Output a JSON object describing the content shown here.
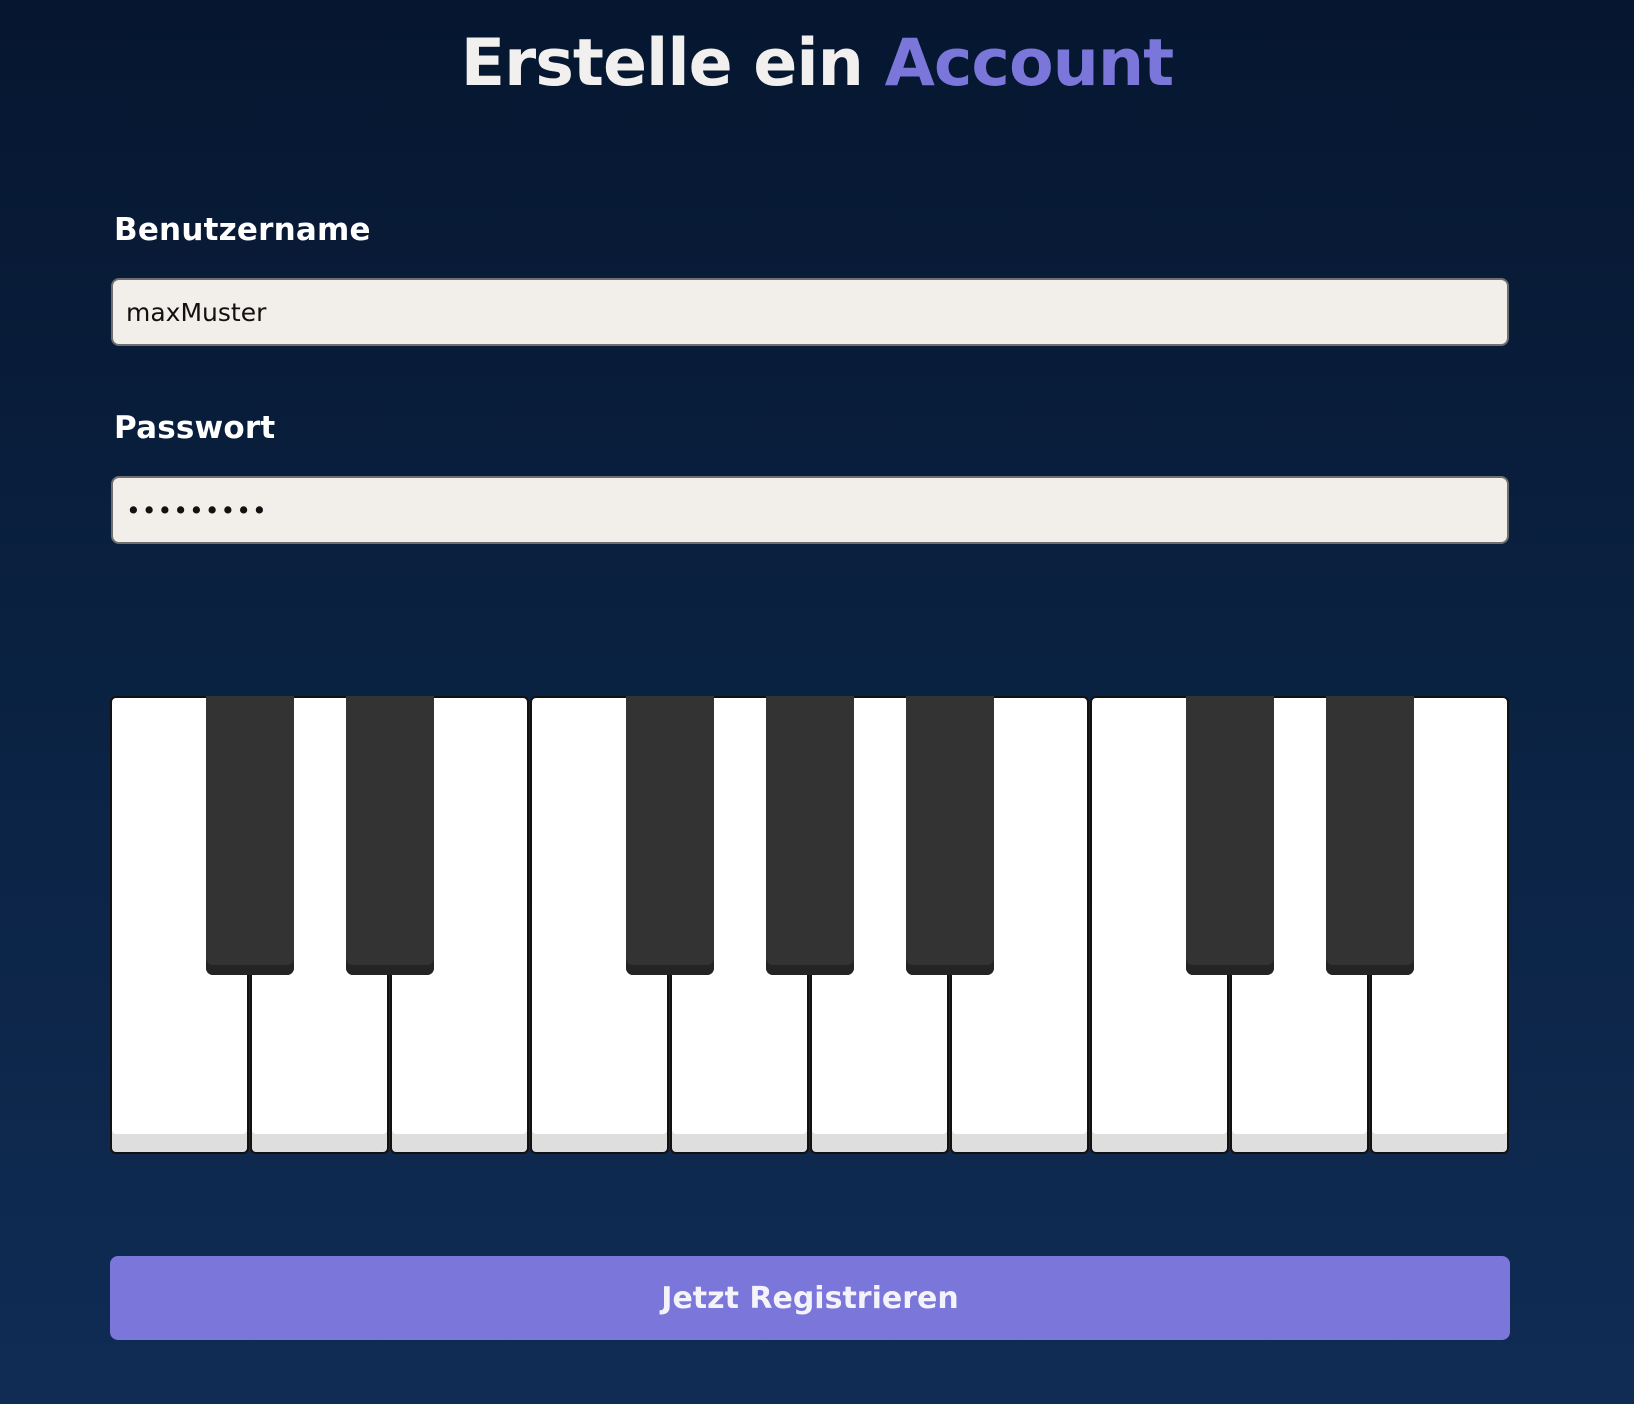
{
  "header": {
    "title_prefix": "Erstelle ein",
    "title_accent": "Account"
  },
  "form": {
    "username": {
      "label": "Benutzername",
      "value": "maxMuster"
    },
    "password": {
      "label": "Passwort",
      "value": "•••••••••"
    },
    "submit_label": "Jetzt Registrieren"
  },
  "piano": {
    "white_keys": 10,
    "black_keys_after_white": [
      0,
      1,
      3,
      4,
      5,
      7,
      8
    ]
  },
  "colors": {
    "background_top": "#061630",
    "background_bottom": "#102c55",
    "accent": "#7b76d9",
    "input_background": "#f2eeea",
    "white_key": "#ffffff",
    "black_key": "#333333"
  }
}
